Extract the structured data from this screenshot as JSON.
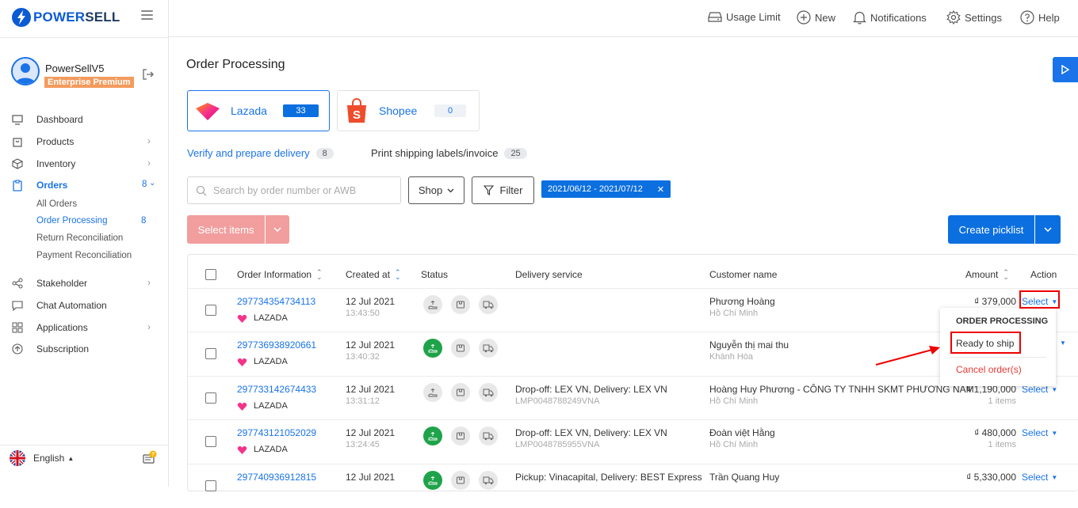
{
  "sidebar": {
    "logo": {
      "part1": "POWER",
      "part2": "SELL"
    },
    "user": {
      "name": "PowerSellV5",
      "plan": "Enterprise Premium"
    },
    "nav": [
      {
        "label": "Dashboard"
      },
      {
        "label": "Products"
      },
      {
        "label": "Inventory"
      },
      {
        "label": "Orders",
        "count": "8"
      },
      {
        "label": "Stakeholder"
      },
      {
        "label": "Chat Automation"
      },
      {
        "label": "Applications"
      },
      {
        "label": "Subscription"
      }
    ],
    "orders_sub": [
      {
        "label": "All Orders"
      },
      {
        "label": "Order Processing",
        "count": "8"
      },
      {
        "label": "Return Reconciliation"
      },
      {
        "label": "Payment Reconciliation"
      }
    ],
    "language": "English"
  },
  "topbar": {
    "usage_limit": "Usage Limit",
    "new": "New",
    "notifications": "Notifications",
    "settings": "Settings",
    "help": "Help"
  },
  "main": {
    "title": "Order Processing",
    "marketplaces": [
      {
        "name": "Lazada",
        "count": "33"
      },
      {
        "name": "Shopee",
        "count": "0"
      }
    ],
    "subtabs": [
      {
        "label": "Verify and prepare delivery",
        "count": "8"
      },
      {
        "label": "Print shipping labels/invoice",
        "count": "25"
      }
    ],
    "search_placeholder": "Search by order number or AWB",
    "shop_button": "Shop",
    "filter_button": "Filter",
    "date_range": "2021/06/12 - 2021/07/12",
    "select_items": "Select items",
    "create_picklist": "Create picklist"
  },
  "table": {
    "headers": {
      "order_info": "Order Information",
      "created_at": "Created at",
      "status": "Status",
      "delivery": "Delivery service",
      "customer": "Customer name",
      "amount": "Amount",
      "action": "Action"
    },
    "rows": [
      {
        "order": "297734354734113",
        "shop": "LAZADA",
        "date": "12 Jul 2021",
        "time": "13:43:50",
        "paid": false,
        "delivery": "",
        "tracking": "",
        "customer": "Phương Hoàng",
        "city": "Hồ Chí Minh",
        "amount": "₫ 379,000",
        "items": "",
        "action": "Select"
      },
      {
        "order": "297736938920661",
        "shop": "LAZADA",
        "date": "12 Jul 2021",
        "time": "13:40:32",
        "paid": true,
        "delivery": "",
        "tracking": "",
        "customer": "Nguyễn thị mai thu",
        "city": "Khánh Hòa",
        "amount": "",
        "items": "",
        "action": ""
      },
      {
        "order": "297733142674433",
        "shop": "LAZADA",
        "date": "12 Jul 2021",
        "time": "13:31:12",
        "paid": false,
        "delivery": "Drop-off: LEX VN, Delivery: LEX VN",
        "tracking": "LMP0048788249VNA",
        "customer": "Hoàng Huy Phương - CÔNG TY TNHH SKMT PHƯƠNG NAM",
        "city": "Hồ Chí Minh",
        "amount": "₫ 1,190,000",
        "items": "1 items",
        "action": "Select"
      },
      {
        "order": "297743121052029",
        "shop": "LAZADA",
        "date": "12 Jul 2021",
        "time": "13:24:45",
        "paid": true,
        "delivery": "Drop-off: LEX VN, Delivery: LEX VN",
        "tracking": "LMP0048785955VNA",
        "customer": "Đoàn việt Hằng",
        "city": "Hồ Chí Minh",
        "amount": "₫ 480,000",
        "items": "1 items",
        "action": "Select"
      },
      {
        "order": "297740936912815",
        "shop": "LAZADA",
        "date": "12 Jul 2021",
        "time": "",
        "paid": true,
        "delivery": "Pickup: Vinacapital, Delivery: BEST Express",
        "tracking": "",
        "customer": "Trần Quang Huy",
        "city": "",
        "amount": "₫ 5,330,000",
        "items": "",
        "action": "Select"
      }
    ]
  },
  "dropdown": {
    "header": "ORDER PROCESSING",
    "ready": "Ready to ship",
    "cancel": "Cancel order(s)"
  },
  "colors": {
    "primary": "#1a73e8",
    "disabled_red": "#f29e9e",
    "badge_orange": "#f39b5d",
    "paid_green": "#1fa34a",
    "highlight": "#e00000"
  }
}
